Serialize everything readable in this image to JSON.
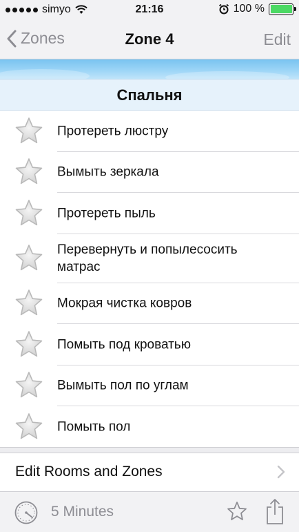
{
  "status_bar": {
    "carrier": "simyo",
    "time": "21:16",
    "battery_percent": "100 %",
    "battery_level": 1.0
  },
  "nav": {
    "back_label": "Zones",
    "title": "Zone 4",
    "edit_label": "Edit"
  },
  "section": {
    "title": "Спальня"
  },
  "tasks": [
    {
      "label": "Протереть люстру"
    },
    {
      "label": "Вымыть зеркала"
    },
    {
      "label": "Протереть пыль"
    },
    {
      "label": "Перевернуть и попылесосить матрас"
    },
    {
      "label": "Мокрая чистка ковров"
    },
    {
      "label": "Помыть под кроватью"
    },
    {
      "label": "Вымыть пол по углам"
    },
    {
      "label": "Помыть пол"
    }
  ],
  "edit_rooms": {
    "label": "Edit Rooms and Zones"
  },
  "toolbar": {
    "timer_label": "5 Minutes"
  },
  "icons": {
    "back": "chevron-left-icon",
    "task_star": "star-icon",
    "disclosure": "chevron-right-icon",
    "timer": "stopwatch-icon",
    "favorite": "star-outline-icon",
    "share": "share-icon",
    "wifi": "wifi-icon",
    "alarm": "alarm-icon",
    "battery": "battery-icon"
  },
  "colors": {
    "nav_tint": "#8d8d93",
    "section_bg": "#e6f2fb",
    "battery_fill": "#4cd964",
    "sky_band": "#79c3f0"
  }
}
